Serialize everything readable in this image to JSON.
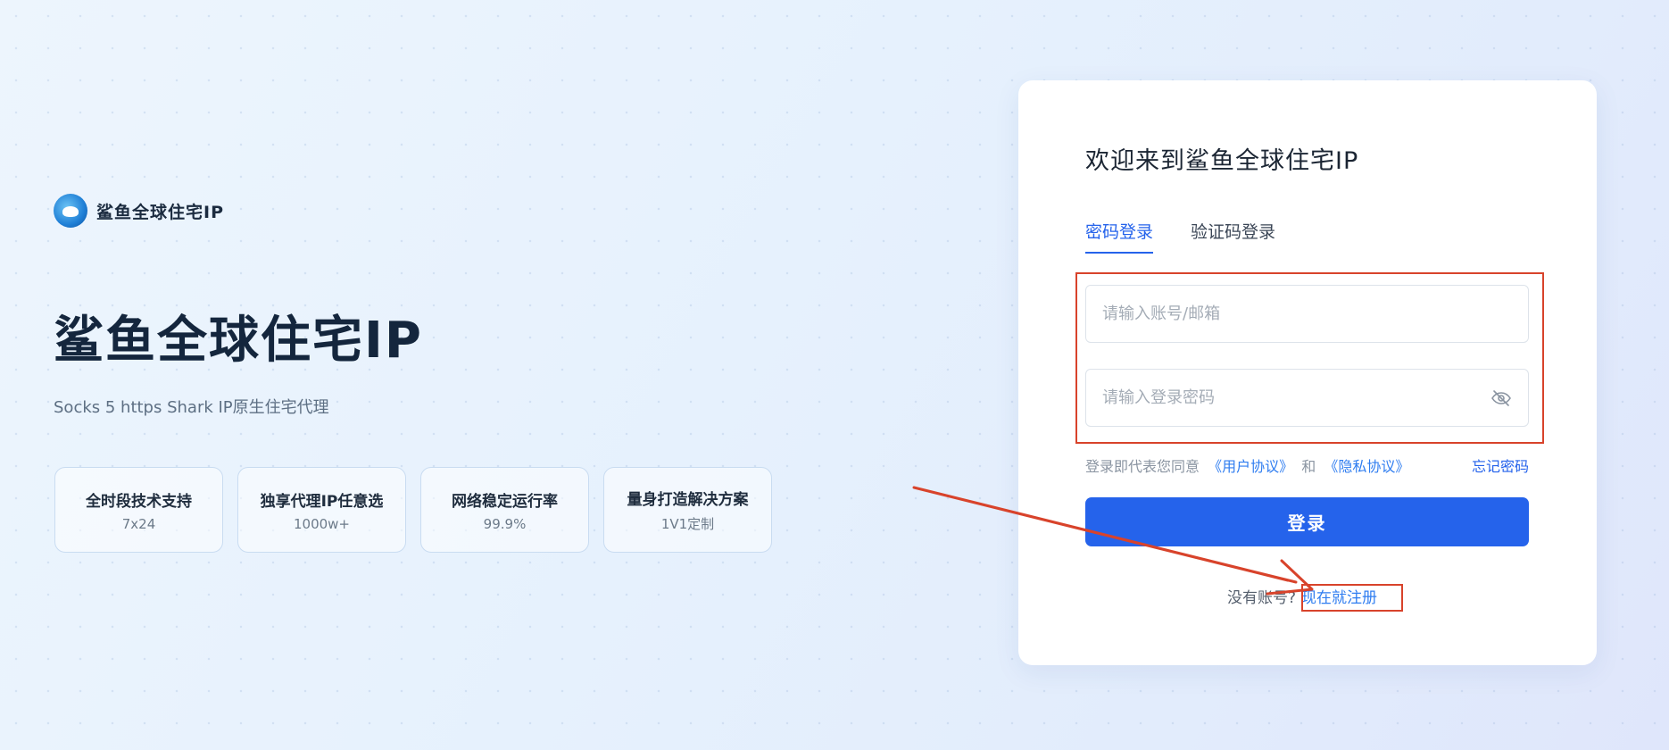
{
  "brand": {
    "name": "鲨鱼全球住宅IP"
  },
  "hero": {
    "title": "鲨鱼全球住宅IP",
    "subtitle": "Socks 5 https Shark IP原生住宅代理"
  },
  "features": [
    {
      "title": "全时段技术支持",
      "value": "7x24"
    },
    {
      "title": "独享代理IP任意选",
      "value": "1000w+"
    },
    {
      "title": "网络稳定运行率",
      "value": "99.9%"
    },
    {
      "title": "量身打造解决方案",
      "value": "1V1定制"
    }
  ],
  "login": {
    "title": "欢迎来到鲨鱼全球住宅IP",
    "tabs": [
      {
        "label": "密码登录",
        "active": true
      },
      {
        "label": "验证码登录",
        "active": false
      }
    ],
    "account_placeholder": "请输入账号/邮箱",
    "password_placeholder": "请输入登录密码",
    "agree_prefix": "登录即代表您同意",
    "user_agreement": "《用户协议》",
    "and": "和",
    "privacy_policy": "《隐私协议》",
    "forgot_password": "忘记密码",
    "submit_label": "登录",
    "no_account": "没有账号?",
    "register_label": "现在就注册"
  },
  "colors": {
    "accent": "#2563eb",
    "annotation": "#d8432b"
  },
  "icons": {
    "password_visibility": "eye-slash-icon"
  }
}
